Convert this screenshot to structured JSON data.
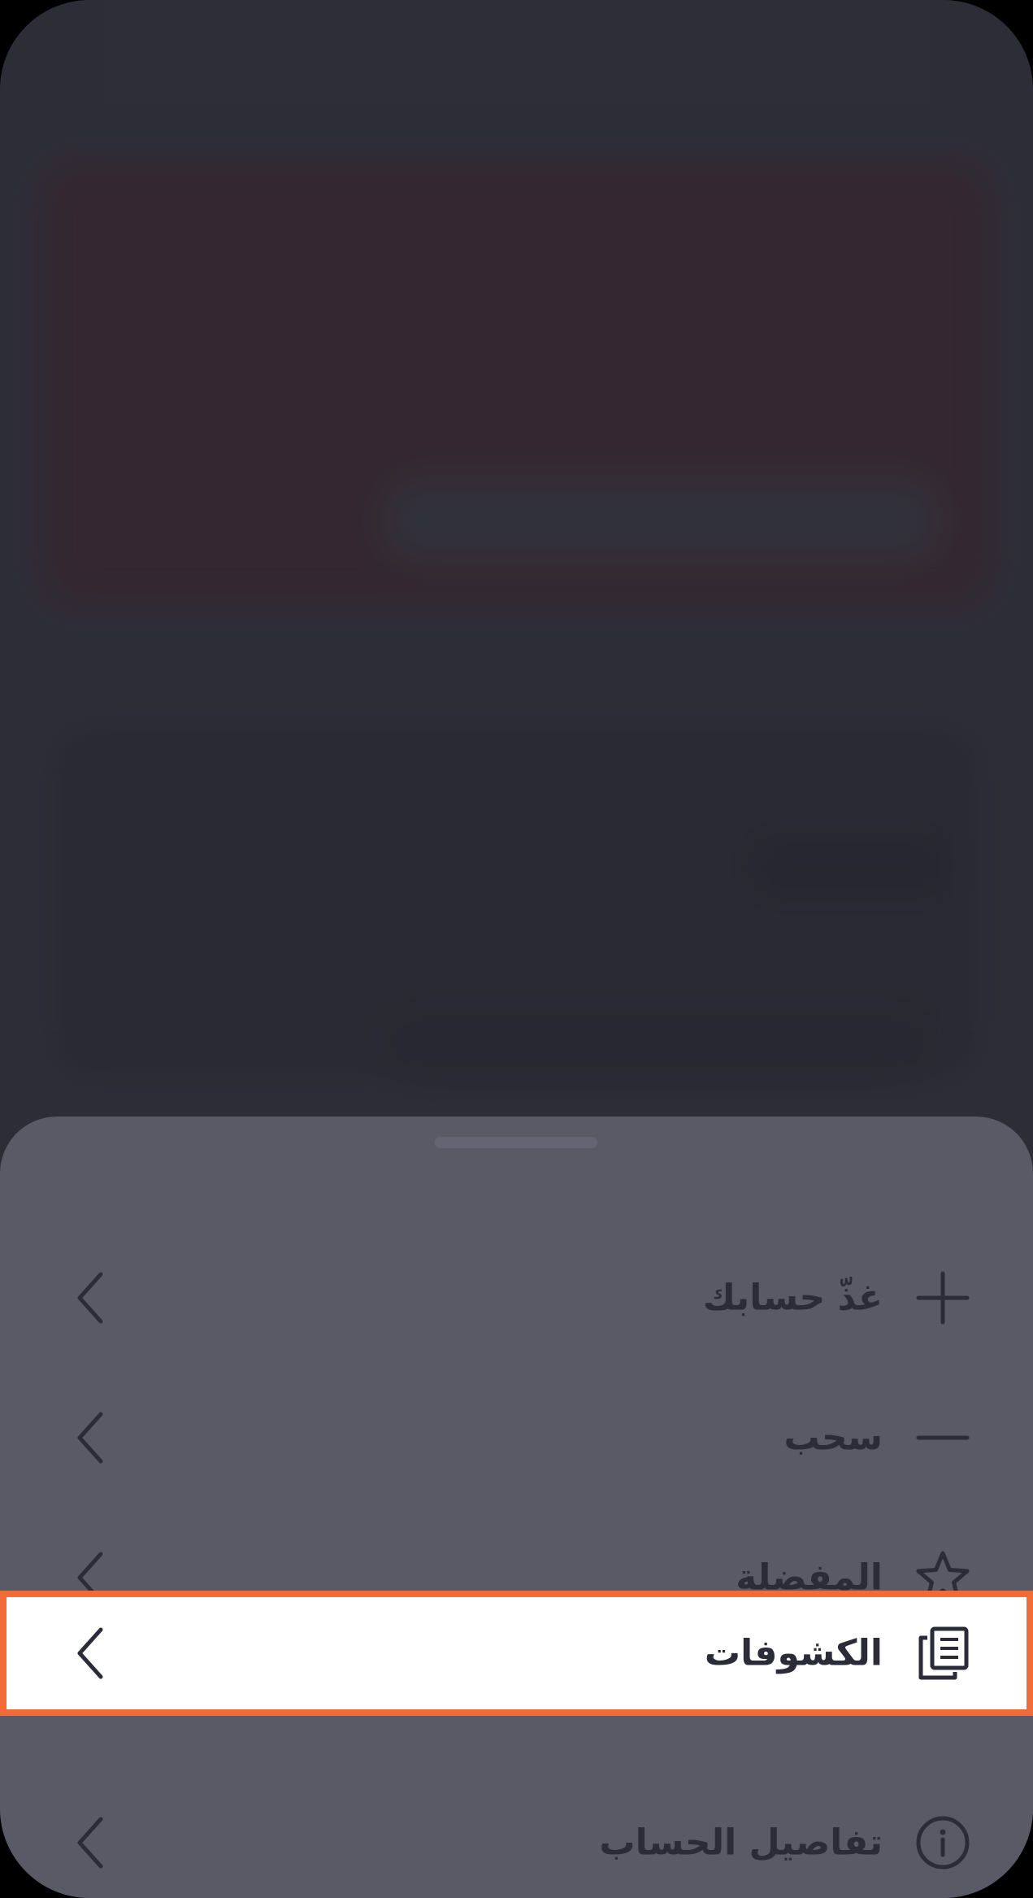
{
  "menu": {
    "items": [
      {
        "label": "غذّ حسابك",
        "icon": "plus-icon"
      },
      {
        "label": "سحب",
        "icon": "minus-icon"
      },
      {
        "label": "المفضلة",
        "icon": "star-icon"
      },
      {
        "label": "الكشوفات",
        "icon": "documents-icon",
        "selected": true
      },
      {
        "label": "تفاصيل الحساب",
        "icon": "info-icon"
      }
    ]
  },
  "colors": {
    "sheet": "#5a5a66",
    "text": "#2c2c38",
    "highlight_border": "#f26a35",
    "highlight_bg": "#ffffff",
    "backdrop": "#353541"
  }
}
